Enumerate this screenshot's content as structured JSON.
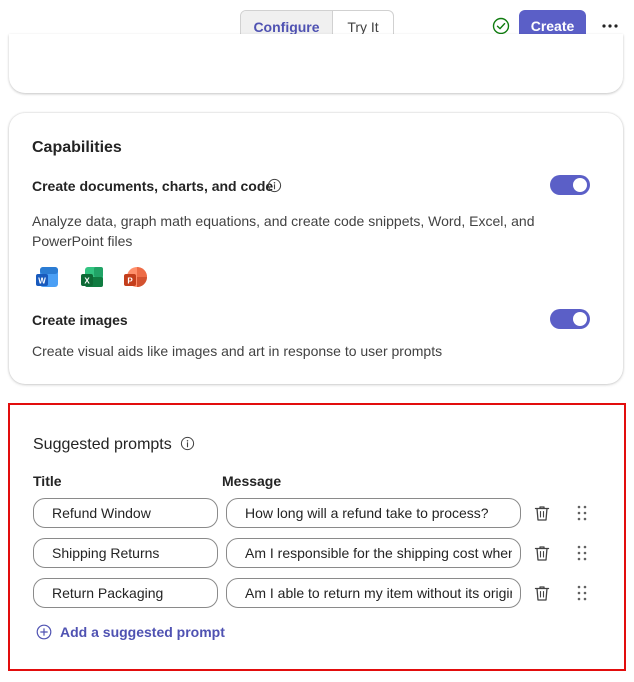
{
  "header": {
    "tabs": [
      {
        "label": "Configure",
        "selected": true
      },
      {
        "label": "Try It",
        "selected": false
      }
    ],
    "status_icon": "check-circle-icon",
    "create_label": "Create",
    "more_icon": "more-horizontal-icon",
    "accent_color": "#5b5fc7"
  },
  "capabilities": {
    "title": "Capabilities",
    "items": [
      {
        "label": "Create documents, charts, and code",
        "description": "Analyze data, graph math equations, and create code snippets, Word, Excel, and PowerPoint files",
        "enabled": true,
        "apps": [
          "word-icon",
          "excel-icon",
          "powerpoint-icon"
        ]
      },
      {
        "label": "Create images",
        "description": "Create visual aids like images and art in response to user prompts",
        "enabled": true
      }
    ]
  },
  "suggested_prompts": {
    "title": "Suggested prompts",
    "columns": {
      "title": "Title",
      "message": "Message"
    },
    "rows": [
      {
        "title": "Refund Window",
        "message": "How long will a refund take to process?"
      },
      {
        "title": "Shipping Returns",
        "message": "Am I responsible for the shipping cost when returning an item?"
      },
      {
        "title": "Return Packaging",
        "message": "Am I able to return my item without its original packaging?"
      }
    ],
    "add_label": "Add a suggested prompt",
    "highlight_color": "#e20d0d"
  }
}
